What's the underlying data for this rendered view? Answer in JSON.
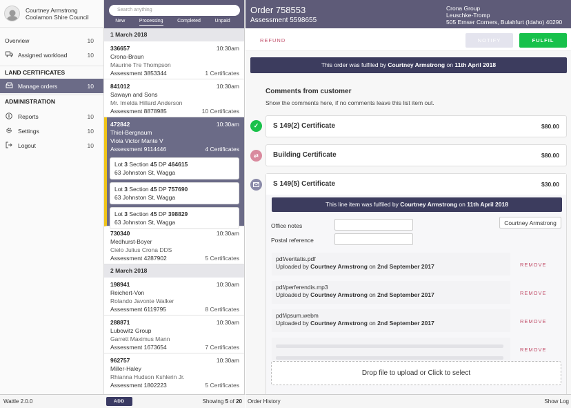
{
  "user": {
    "name": "Courtney Armstrong",
    "org": "Coolamon Shire Council"
  },
  "nav": {
    "overview": {
      "label": "Overview",
      "count": "10"
    },
    "assigned": {
      "label": "Assigned workload",
      "count": "10",
      "icon": "truck-icon"
    },
    "section_land": "LAND CERTIFICATES",
    "manage": {
      "label": "Manage orders",
      "count": "10",
      "icon": "inbox-icon"
    },
    "section_admin": "ADMINISTRATION",
    "reports": {
      "label": "Reports",
      "count": "10",
      "icon": "info-icon"
    },
    "settings": {
      "label": "Settings",
      "count": "10",
      "icon": "gear-icon"
    },
    "logout": {
      "label": "Logout",
      "count": "10",
      "icon": "logout-icon"
    }
  },
  "version": "Wattle 2.0.0",
  "search": {
    "placeholder": "Search anything"
  },
  "tabs": [
    "New",
    "Processing",
    "Completed",
    "Unpaid"
  ],
  "groups": [
    {
      "date": "1 March 2018"
    },
    {
      "date": "2 March 2018"
    }
  ],
  "orders": [
    {
      "id": "336657",
      "time": "10:30am",
      "company": "Crona-Braun",
      "contact": "Maurine Tre Thompson",
      "assessment": "Assessment 3853344",
      "certs": "1 Certificates"
    },
    {
      "id": "841012",
      "time": "10:30am",
      "company": "Sawayn and Sons",
      "contact": "Mr. Imelda Hillard Anderson",
      "assessment": "Assessment 8878985",
      "certs": "10 Certificates"
    },
    {
      "id": "472842",
      "time": "10:30am",
      "company": "Thiel-Bergnaum",
      "contact": "Viola Victor Mante V",
      "assessment": "Assessment 9114446",
      "certs": "4 Certificates",
      "lots": [
        {
          "lot_kw": "Lot",
          "lot": "3",
          "sec_kw": "Section",
          "section": "45",
          "dp_kw": "DP",
          "dp": "464615",
          "address": "63 Johnston St, Wagga"
        },
        {
          "lot_kw": "Lot",
          "lot": "3",
          "sec_kw": "Section",
          "section": "45",
          "dp_kw": "DP",
          "dp": "757690",
          "address": "63 Johnston St, Wagga"
        },
        {
          "lot_kw": "Lot",
          "lot": "3",
          "sec_kw": "Section",
          "section": "45",
          "dp_kw": "DP",
          "dp": "398829",
          "address": "63 Johnston St, Wagga"
        }
      ]
    },
    {
      "id": "730340",
      "time": "10:30am",
      "company": "Medhurst-Boyer",
      "contact": "Cielo Julius Crona DDS",
      "assessment": "Assessment 4287902",
      "certs": "5 Certificates"
    },
    {
      "id": "198941",
      "time": "10:30am",
      "company": "Reichert-Von",
      "contact": "Rolando Javonte Walker",
      "assessment": "Assessment 6119795",
      "certs": "8 Certificates"
    },
    {
      "id": "288871",
      "time": "10:30am",
      "company": "Lubowitz Group",
      "contact": "Garrett Maximus Mann",
      "assessment": "Assessment 1673654",
      "certs": "7 Certificates"
    },
    {
      "id": "962757",
      "time": "10:30am",
      "company": "Miller-Haley",
      "contact": "Rhianna Hudson Kshlerin Jr.",
      "assessment": "Assessment 1802223",
      "certs": "5 Certificates"
    }
  ],
  "list_footer": {
    "add": "ADD",
    "showing_pre": "Showing",
    "showing_n": "5",
    "showing_of": "of",
    "showing_total": "20"
  },
  "order": {
    "title": "Order 758553",
    "assessment": "Assessment 5598655",
    "address": [
      "Crona Group",
      "Leuschke-Tromp",
      "505 Ernser Corners, Bulahfurt (Idaho) 40290"
    ]
  },
  "actions": {
    "refund": "REFUND",
    "notify": "NOTIFY",
    "fulfil": "FULFIL"
  },
  "banner": {
    "pre": "This order was fulfiled by",
    "who": "Courtney Armstrong",
    "mid": "on",
    "date": "11th April 2018"
  },
  "comments": {
    "title": "Comments from customer",
    "sub": "Show the comments here, if no comments leave this list item out."
  },
  "items": [
    {
      "name": "S 149(2) Certificate",
      "price": "$80.00",
      "status_icon": "check-icon",
      "status_color": "#19c14a"
    },
    {
      "name": "Building Certificate",
      "price": "$80.00",
      "status_icon": "shuffle-icon",
      "status_color": "#d98a9e"
    },
    {
      "name": "S 149(5) Certificate",
      "price": "$30.00",
      "status_icon": "mail-icon",
      "status_color": "#8a8aa8"
    }
  ],
  "line_banner": {
    "pre": "This line item was fulfiled by",
    "who": "Courtney Armstrong",
    "mid": "on",
    "date": "11th April 2018"
  },
  "fields": {
    "office_notes": "Office notes",
    "postal_ref": "Postal reference",
    "assignee": "Courtney Armstrong"
  },
  "files": [
    {
      "name": "pdf/veritatis.pdf",
      "up_pre": "Uploaded by",
      "who": "Courtney Armstrong",
      "on": "on",
      "date": "2nd September 2017",
      "remove": "REMOVE"
    },
    {
      "name": "pdf/perferendis.mp3",
      "up_pre": "Uploaded by",
      "who": "Courtney Armstrong",
      "on": "on",
      "date": "2nd September 2017",
      "remove": "REMOVE"
    },
    {
      "name": "pdf/ipsum.webm",
      "up_pre": "Uploaded by",
      "who": "Courtney Armstrong",
      "on": "on",
      "date": "2nd September 2017",
      "remove": "REMOVE"
    },
    {
      "remove": "REMOVE"
    }
  ],
  "drop": "Drop file to upload or Click to select",
  "footer": {
    "history": "Order History",
    "log": "Show Log"
  }
}
